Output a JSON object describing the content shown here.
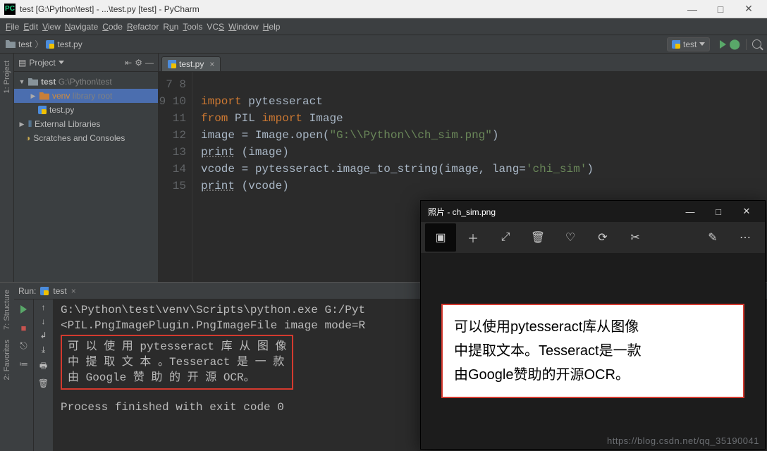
{
  "window": {
    "title": "test [G:\\Python\\test] - ...\\test.py [test] - PyCharm"
  },
  "menu": [
    "File",
    "Edit",
    "View",
    "Navigate",
    "Code",
    "Refactor",
    "Run",
    "Tools",
    "VCS",
    "Window",
    "Help"
  ],
  "breadcrumbs": {
    "root": "test",
    "file": "test.py"
  },
  "runconfig": {
    "name": "test"
  },
  "project": {
    "title": "Project",
    "root_name": "test",
    "root_path": "G:\\Python\\test",
    "venv": "venv",
    "venv_hint": "library root",
    "file": "test.py",
    "external": "External Libraries",
    "scratches": "Scratches and Consoles"
  },
  "tabs": {
    "active": "test.py"
  },
  "code": {
    "line_start": 7,
    "lines": [
      "",
      "import pytesseract",
      "from PIL import Image",
      "image = Image.open(\"G:\\\\Python\\\\ch_sim.png\")",
      "print (image)",
      "vcode = pytesseract.image_to_string(image, lang='chi_sim')",
      "print (vcode)",
      "",
      ""
    ]
  },
  "run": {
    "label": "Run:",
    "config": "test",
    "header": "G:\\Python\\test\\venv\\Scripts\\python.exe G:/Pyt",
    "line2": "<PIL.PngImagePlugin.PngImageFile image mode=R",
    "ocr_l1": "可 以 使 用 pytesseract 库 从 图 像",
    "ocr_l2": "中 提 取 文 本 。Tesseract 是 一 款",
    "ocr_l3": "由 Google 赞 助 的 开 源 OCR。",
    "exit": "Process finished with exit code 0"
  },
  "photos": {
    "title": "照片 - ch_sim.png",
    "image_l1": "可以使用pytesseract库从图像",
    "image_l2": "中提取文本。Tesseract是一款",
    "image_l3": "由Google赞助的开源OCR。"
  },
  "sidebars": {
    "project": "1: Project",
    "structure": "7: Structure",
    "favorites": "2: Favorites"
  },
  "watermark": "https://blog.csdn.net/qq_35190041"
}
